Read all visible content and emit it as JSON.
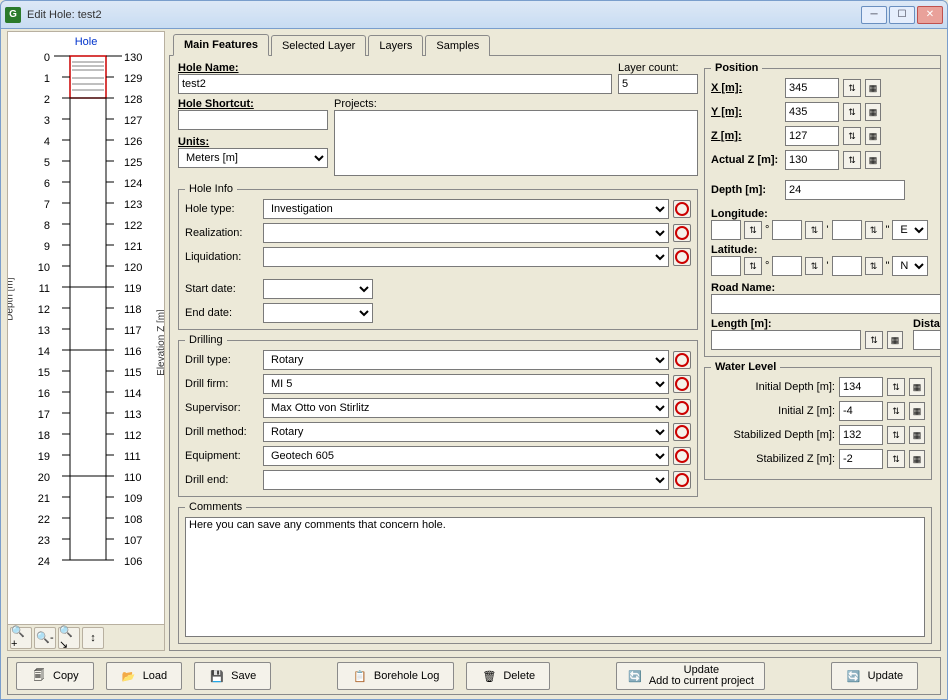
{
  "window": {
    "title": "Edit Hole: test2"
  },
  "tabs": [
    "Main Features",
    "Selected Layer",
    "Layers",
    "Samples"
  ],
  "left": {
    "title": "Hole"
  },
  "labels": {
    "hole_name": "Hole Name:",
    "layer_count": "Layer count:",
    "hole_shortcut": "Hole Shortcut:",
    "projects": "Projects:",
    "units": "Units:",
    "hole_info": "Hole Info",
    "hole_type": "Hole type:",
    "realization": "Realization:",
    "liquidation": "Liquidation:",
    "start_date": "Start date:",
    "end_date": "End date:",
    "drilling": "Drilling",
    "drill_type": "Drill type:",
    "drill_firm": "Drill firm:",
    "supervisor": "Supervisor:",
    "drill_method": "Drill method:",
    "equipment": "Equipment:",
    "drill_end": "Drill end:",
    "comments": "Comments",
    "position": "Position",
    "x": "X [m]:",
    "y": "Y [m]:",
    "z": "Z [m]:",
    "actual_z": "Actual Z [m]:",
    "depth": "Depth [m]:",
    "longitude": "Longitude:",
    "latitude": "Latitude:",
    "road_name": "Road Name:",
    "length": "Length [m]:",
    "distance": "Distance [m]:",
    "water_level": "Water Level",
    "initial_depth": "Initial Depth [m]:",
    "initial_z": "Initial Z [m]:",
    "stabilized_depth": "Stabilized Depth [m]:",
    "stabilized_z": "Stabilized Z [m]:",
    "depth_axis": "Depth [m]",
    "elev_axis": "Elevation Z [m]"
  },
  "values": {
    "hole_name": "test2",
    "layer_count": "5",
    "hole_shortcut": "",
    "projects": "",
    "units": "Meters [m]",
    "hole_type": "Investigation",
    "realization": "",
    "liquidation": "",
    "start_date": "",
    "end_date": "",
    "drill_type": "Rotary",
    "drill_firm": "MI 5",
    "supervisor": "Max Otto von Stirlitz",
    "drill_method": "Rotary",
    "equipment": "Geotech 605",
    "drill_end": "",
    "comments": "Here you can save any comments that concern hole.",
    "x": "345",
    "y": "435",
    "z": "127",
    "actual_z": "130",
    "depth": "24",
    "lon_dir": "E",
    "lat_dir": "N",
    "road_name": "",
    "length": "",
    "distance": "",
    "initial_depth": "134",
    "initial_z": "-4",
    "stabilized_depth": "132",
    "stabilized_z": "-2"
  },
  "buttons": {
    "copy": "Copy",
    "load": "Load",
    "save": "Save",
    "borehole_log": "Borehole Log",
    "delete": "Delete",
    "update_project1": "Update",
    "update_project2": "Add to current project",
    "update": "Update"
  },
  "chart_data": {
    "type": "borehole-log",
    "depth_range": [
      0,
      24
    ],
    "elevation_range": [
      130,
      106
    ],
    "depth_ticks": [
      0,
      1,
      2,
      3,
      4,
      5,
      6,
      7,
      8,
      9,
      10,
      11,
      12,
      13,
      14,
      15,
      16,
      17,
      18,
      19,
      20,
      21,
      22,
      23,
      24
    ],
    "elevation_ticks": [
      130,
      129,
      128,
      127,
      126,
      125,
      124,
      123,
      122,
      121,
      120,
      119,
      118,
      117,
      116,
      115,
      114,
      113,
      112,
      111,
      110,
      109,
      108,
      107,
      106
    ],
    "layers": [
      {
        "from": 0,
        "to": 2,
        "pattern": "topsoil",
        "highlight": true
      },
      {
        "from": 2,
        "to": 11,
        "pattern": "sand-dense"
      },
      {
        "from": 11,
        "to": 14,
        "pattern": "sand-dashed"
      },
      {
        "from": 14,
        "to": 20,
        "pattern": "sand-sparse"
      },
      {
        "from": 20,
        "to": 24,
        "pattern": "silt"
      }
    ]
  }
}
